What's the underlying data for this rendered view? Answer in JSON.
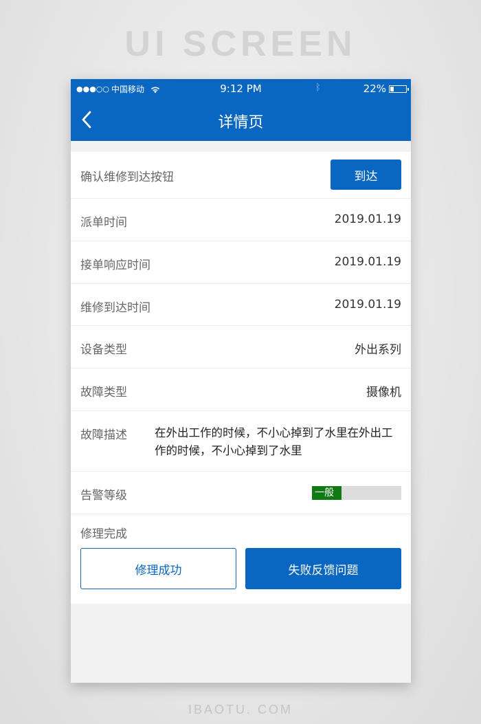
{
  "watermark": {
    "top": "UI SCREEN",
    "bottom": "IBAOTU. COM"
  },
  "statusbar": {
    "signal": "●●●○○",
    "carrier": "中国移动",
    "time": "9:12 PM",
    "battery": "22%",
    "battery_level": 0.22
  },
  "header": {
    "title": "详情页"
  },
  "confirm": {
    "label": "确认维修到达按钮",
    "button": "到达"
  },
  "rows": [
    {
      "label": "派单时间",
      "value": "2019.01.19"
    },
    {
      "label": "接单响应时间",
      "value": "2019.01.19"
    },
    {
      "label": "维修到达时间",
      "value": "2019.01.19"
    },
    {
      "label": "设备类型",
      "value": "外出系列"
    },
    {
      "label": "故障类型",
      "value": "摄像机"
    }
  ],
  "fault": {
    "label": "故障描述",
    "text": "在外出工作的时候，不小心掉到了水里在外出工作的时候，不小心掉到了水里"
  },
  "alarm": {
    "label": "告警等级",
    "level_text": "一般",
    "level_fraction": 0.33,
    "color": "#0f7a14"
  },
  "complete": {
    "label": "修理完成",
    "success_button": "修理成功",
    "fail_button": "失败反馈问题"
  },
  "colors": {
    "primary": "#0a67c1"
  }
}
